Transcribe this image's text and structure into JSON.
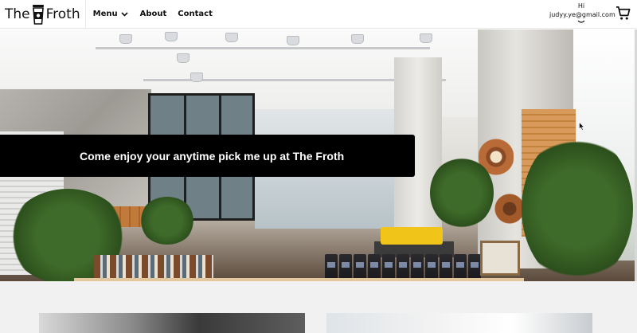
{
  "nav": {
    "brand": {
      "left": "The",
      "right": "Froth"
    },
    "links": [
      {
        "label": "Menu"
      },
      {
        "label": "About"
      },
      {
        "label": "Contact"
      }
    ],
    "user": {
      "greeting": "Hi",
      "email": "judyy.ye@gmail.com"
    },
    "icons": {
      "logo": "coffee-cup-icon",
      "menu_dropdown": "chevron-down-icon",
      "user_dropdown": "chevron-down-icon",
      "cart": "shopping-cart-icon"
    }
  },
  "hero": {
    "tagline": "Come enjoy your anytime pick me up at The Froth"
  },
  "colors": {
    "banner_background": "#000000",
    "banner_text": "#ffffff",
    "page_background": "#f1f1f1"
  }
}
